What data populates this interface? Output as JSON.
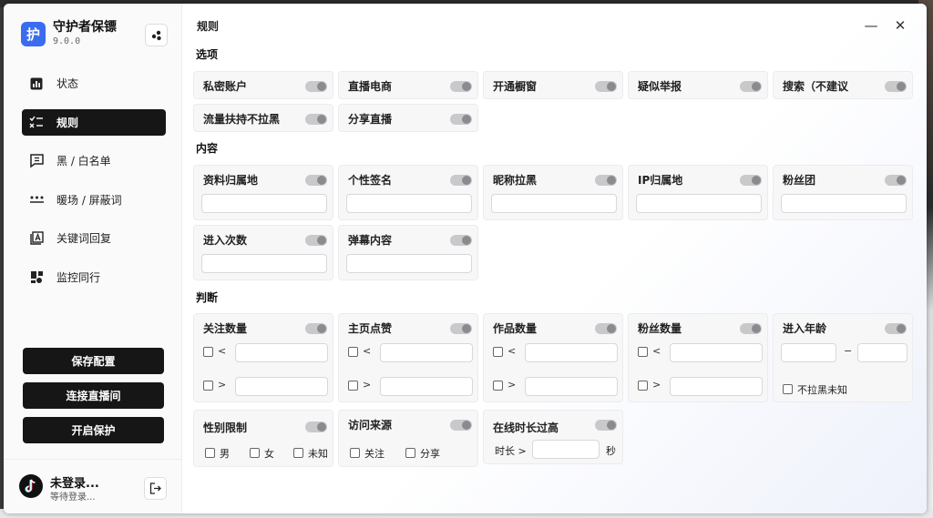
{
  "app": {
    "logo_char": "护",
    "name": "守护者保镖",
    "version": "9.0.0"
  },
  "nav": [
    {
      "label": "状态",
      "icon": "bar-chart-icon"
    },
    {
      "label": "规则",
      "icon": "rules-icon",
      "active": true
    },
    {
      "label": "黑 / 白名单",
      "icon": "list-bubble-icon"
    },
    {
      "label": "暖场 / 屏蔽词",
      "icon": "dots-icon"
    },
    {
      "label": "关键词回复",
      "icon": "keyword-icon"
    },
    {
      "label": "监控同行",
      "icon": "monitor-icon"
    }
  ],
  "actions": {
    "save": "保存配置",
    "connect": "连接直播间",
    "protect": "开启保护"
  },
  "user": {
    "name": "未登录...",
    "status": "等待登录..."
  },
  "page": {
    "title": "规则"
  },
  "sections": {
    "options": "选项",
    "content": "内容",
    "judge": "判断"
  },
  "options": [
    "私密账户",
    "直播电商",
    "开通橱窗",
    "疑似举报",
    "搜索（不建议",
    "流量扶持不拉黑",
    "分享直播"
  ],
  "content": [
    "资料归属地",
    "个性签名",
    "昵称拉黑",
    "IP归属地",
    "粉丝团",
    "进入次数",
    "弹幕内容"
  ],
  "judge": {
    "follow": "关注数量",
    "likes": "主页点赞",
    "works": "作品数量",
    "fans": "粉丝数量",
    "age": "进入年龄",
    "lt": "<",
    "gt": ">",
    "dash": "−",
    "no_block_unknown": "不拉黑未知",
    "gender": "性别限制",
    "male": "男",
    "female": "女",
    "unknown": "未知",
    "source": "访问来源",
    "src_follow": "关注",
    "src_share": "分享",
    "online": "在线时长过高",
    "duration": "时长 >",
    "seconds": "秒"
  },
  "colors": {
    "accent": "#3b6cf0",
    "dark": "#161616",
    "toggle_off": "#c9c9cc"
  }
}
